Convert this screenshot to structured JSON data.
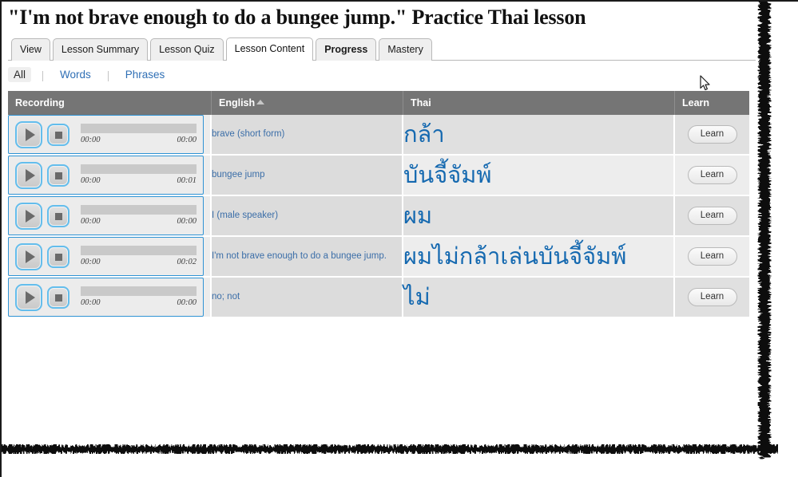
{
  "page": {
    "title": "\"I'm not brave enough to do a bungee jump.\" Practice Thai lesson"
  },
  "tabs": [
    {
      "label": "View",
      "active": false,
      "bold": false
    },
    {
      "label": "Lesson Summary",
      "active": false,
      "bold": false
    },
    {
      "label": "Lesson Quiz",
      "active": false,
      "bold": false
    },
    {
      "label": "Lesson Content",
      "active": true,
      "bold": false
    },
    {
      "label": "Progress",
      "active": false,
      "bold": true
    },
    {
      "label": "Mastery",
      "active": false,
      "bold": false
    }
  ],
  "filters": [
    {
      "label": "All",
      "active": true
    },
    {
      "label": "Words",
      "active": false
    },
    {
      "label": "Phrases",
      "active": false
    }
  ],
  "table": {
    "columns": [
      {
        "key": "recording",
        "label": "Recording",
        "sort": "none"
      },
      {
        "key": "english",
        "label": "English",
        "sort": "asc"
      },
      {
        "key": "thai",
        "label": "Thai",
        "sort": "none"
      },
      {
        "key": "learn",
        "label": "Learn",
        "sort": "none"
      }
    ],
    "learn_label": "Learn",
    "rows": [
      {
        "english": "brave (short form)",
        "thai": "กล้า",
        "time_current": "00:00",
        "time_total": "00:00",
        "learn": "Learn"
      },
      {
        "english": "bungee jump",
        "thai": "บันจี้จัมพ์",
        "time_current": "00:00",
        "time_total": "00:01",
        "learn": "Learn"
      },
      {
        "english": "I (male speaker)",
        "thai": "ผม",
        "time_current": "00:00",
        "time_total": "00:00",
        "learn": "Learn"
      },
      {
        "english": "I'm not brave enough to do a bungee jump.",
        "thai": "ผมไม่กล้าเล่นบันจี้จัมพ์",
        "time_current": "00:00",
        "time_total": "00:02",
        "learn": "Learn"
      },
      {
        "english": "no; not",
        "thai": "ไม่",
        "time_current": "00:00",
        "time_total": "00:00",
        "learn": "Learn"
      }
    ]
  },
  "icons": {
    "play": "play-icon",
    "stop": "stop-icon",
    "sort_asc": "sort-ascending-icon",
    "cursor": "mouse-cursor-arrow"
  },
  "colors": {
    "header_bg": "#757575",
    "link": "#2f6fb5",
    "thai_text": "#1569b0",
    "player_border": "#2f93d4",
    "button_ring": "#63bdec",
    "row_odd": "#e0e0e0",
    "row_even": "#ededed",
    "english_col": "#dcdcdc",
    "recording_col": "#ececec"
  }
}
